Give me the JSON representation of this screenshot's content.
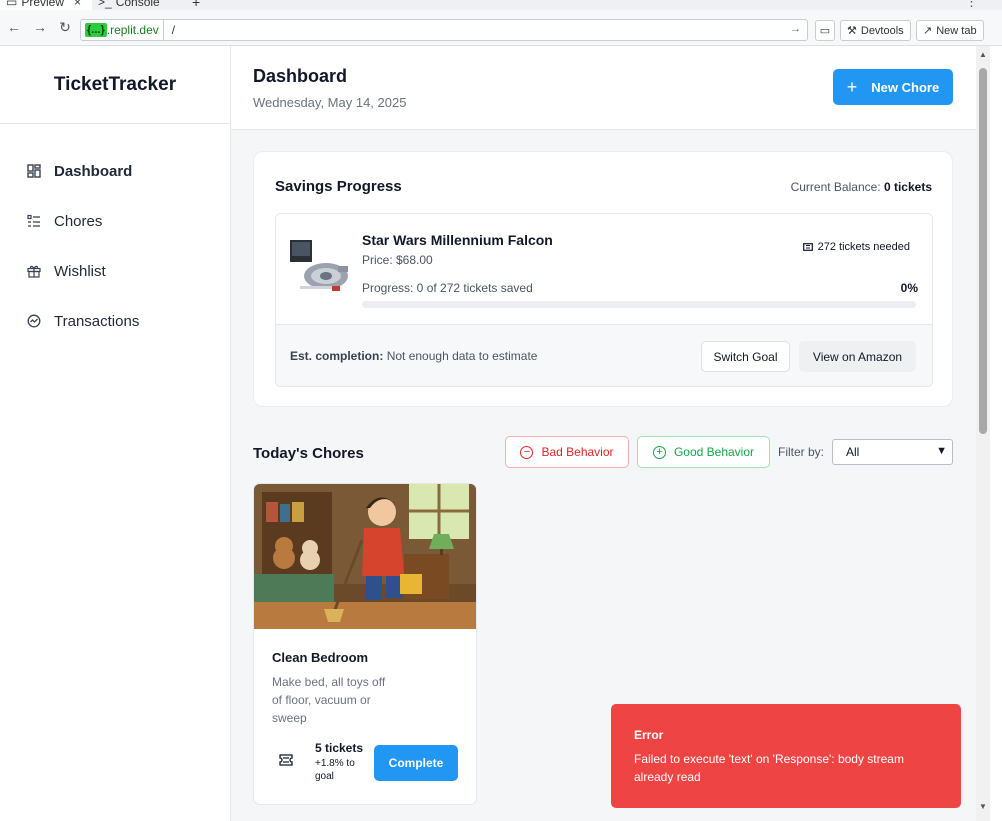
{
  "browser": {
    "tabs": [
      {
        "label": "Preview",
        "close": "×"
      },
      {
        "label": "Console"
      }
    ],
    "new_tab_symbol": "+",
    "menu_symbol": "⋮",
    "url": {
      "host_badge": "{...}",
      "domain": ".replit.dev",
      "path": "/"
    },
    "buttons": {
      "devtools": "Devtools",
      "new_tab": "New tab"
    }
  },
  "sidebar": {
    "brand": "TicketTracker",
    "items": [
      {
        "label": "Dashboard",
        "icon": "dashboard-icon",
        "active": true
      },
      {
        "label": "Chores",
        "icon": "list-icon",
        "active": false
      },
      {
        "label": "Wishlist",
        "icon": "gift-icon",
        "active": false
      },
      {
        "label": "Transactions",
        "icon": "activity-icon",
        "active": false
      }
    ]
  },
  "header": {
    "title": "Dashboard",
    "date": "Wednesday, May 14, 2025",
    "new_chore": "New Chore"
  },
  "savings": {
    "title": "Savings Progress",
    "balance_label": "Current Balance:",
    "balance_value": "0 tickets",
    "goal": {
      "name": "Star Wars Millennium Falcon",
      "price": "Price: $68.00",
      "needed": "272 tickets needed",
      "progress_text": "Progress: 0 of 272 tickets saved",
      "progress_pct": "0%",
      "progress_value": 0,
      "est_label": "Est. completion:",
      "est_value": "Not enough data to estimate",
      "switch_goal": "Switch Goal",
      "view_amazon": "View on Amazon"
    }
  },
  "chores": {
    "title": "Today's Chores",
    "bad_behavior": "Bad Behavior",
    "good_behavior": "Good Behavior",
    "filter_label": "Filter by:",
    "filter_value": "All",
    "items": [
      {
        "name": "Clean Bedroom",
        "description": "Make bed, all toys off of floor, vacuum or sweep",
        "tickets": "5 tickets",
        "goal_pct": "+1.8% to goal",
        "complete": "Complete"
      }
    ]
  },
  "toast": {
    "title": "Error",
    "message": "Failed to execute 'text' on 'Response': body stream already read"
  },
  "colors": {
    "primary": "#2196f3",
    "error": "#ef4444",
    "bad": "#dc2626",
    "good": "#16a34a"
  }
}
